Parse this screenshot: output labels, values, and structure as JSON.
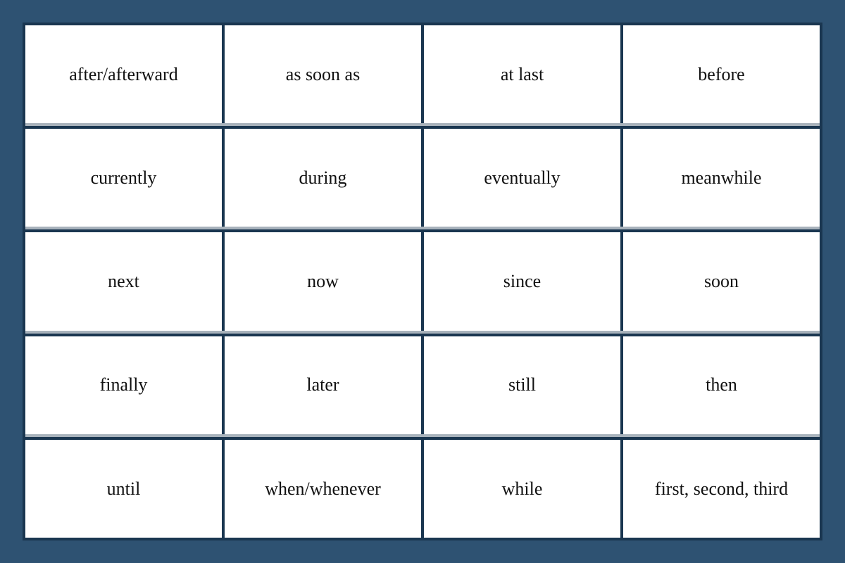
{
  "colors": {
    "background": "#2e5272",
    "cell_bg": "#ffffff",
    "border_vertical": "#1a3650",
    "border_horizontal_gray": "#a0aab0",
    "text": "#111111"
  },
  "cells": [
    {
      "id": "r1c1",
      "text": "after/afterward"
    },
    {
      "id": "r1c2",
      "text": "as soon as"
    },
    {
      "id": "r1c3",
      "text": "at last"
    },
    {
      "id": "r1c4",
      "text": "before"
    },
    {
      "id": "r2c1",
      "text": "currently"
    },
    {
      "id": "r2c2",
      "text": "during"
    },
    {
      "id": "r2c3",
      "text": "eventually"
    },
    {
      "id": "r2c4",
      "text": "meanwhile"
    },
    {
      "id": "r3c1",
      "text": "next"
    },
    {
      "id": "r3c2",
      "text": "now"
    },
    {
      "id": "r3c3",
      "text": "since"
    },
    {
      "id": "r3c4",
      "text": "soon"
    },
    {
      "id": "r4c1",
      "text": "finally"
    },
    {
      "id": "r4c2",
      "text": "later"
    },
    {
      "id": "r4c3",
      "text": "still"
    },
    {
      "id": "r4c4",
      "text": "then"
    },
    {
      "id": "r5c1",
      "text": "until"
    },
    {
      "id": "r5c2",
      "text": "when/whenever"
    },
    {
      "id": "r5c3",
      "text": "while"
    },
    {
      "id": "r5c4",
      "text": "first, second, third"
    }
  ]
}
